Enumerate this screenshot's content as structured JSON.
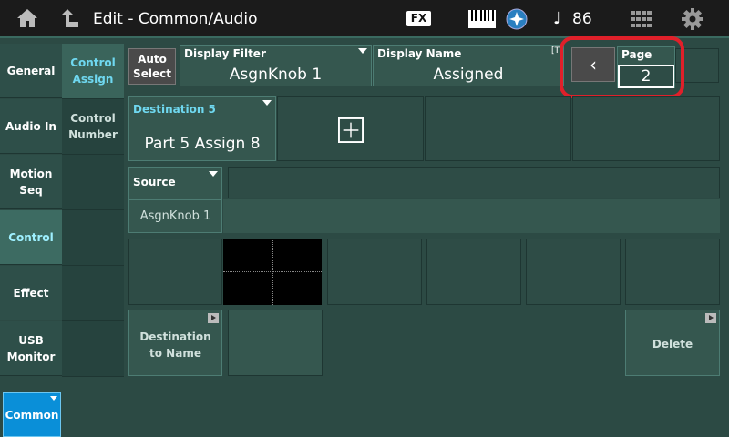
{
  "topbar": {
    "title": "Edit - Common/Audio",
    "fx_label": "FX",
    "note_glyph": "♩",
    "tempo": "86",
    "icons": [
      "home-icon",
      "up-arrow-icon",
      "keyboard-icon",
      "globe-icon",
      "grid-icon",
      "gear-icon"
    ]
  },
  "leftnav": {
    "items": [
      {
        "label": "General",
        "active": false
      },
      {
        "label": "Audio In",
        "active": false
      },
      {
        "label": "Motion\nSeq",
        "active": false
      },
      {
        "label": "Control",
        "active": true
      },
      {
        "label": "Effect",
        "active": false
      },
      {
        "label": "USB\nMonitor",
        "active": false
      }
    ]
  },
  "subnav": {
    "items": [
      {
        "label": "Control\nAssign",
        "active": true
      },
      {
        "label": "Control\nNumber",
        "active": false
      }
    ]
  },
  "toolbar": {
    "auto_select": "Auto\nSelect",
    "display_filter_label": "Display Filter",
    "display_filter_value": "AsgnKnob 1",
    "display_name_label": "Display Name",
    "display_name_value": "Assigned",
    "display_name_marker": "[T",
    "page_back": "‹",
    "page_label": "Page",
    "page_value": "2"
  },
  "destination": {
    "label": "Destination 5",
    "value": "Part 5 Assign 8"
  },
  "source": {
    "label": "Source",
    "value": "AsgnKnob 1"
  },
  "actions": {
    "destination_to_name": "Destination\nto Name",
    "delete": "Delete"
  },
  "bottom": {
    "common": "Common"
  },
  "colors": {
    "background": "#2c4a44",
    "accent_text": "#6fd8f0",
    "highlight": "#e0202a",
    "common_tab": "#0a8fd8"
  }
}
